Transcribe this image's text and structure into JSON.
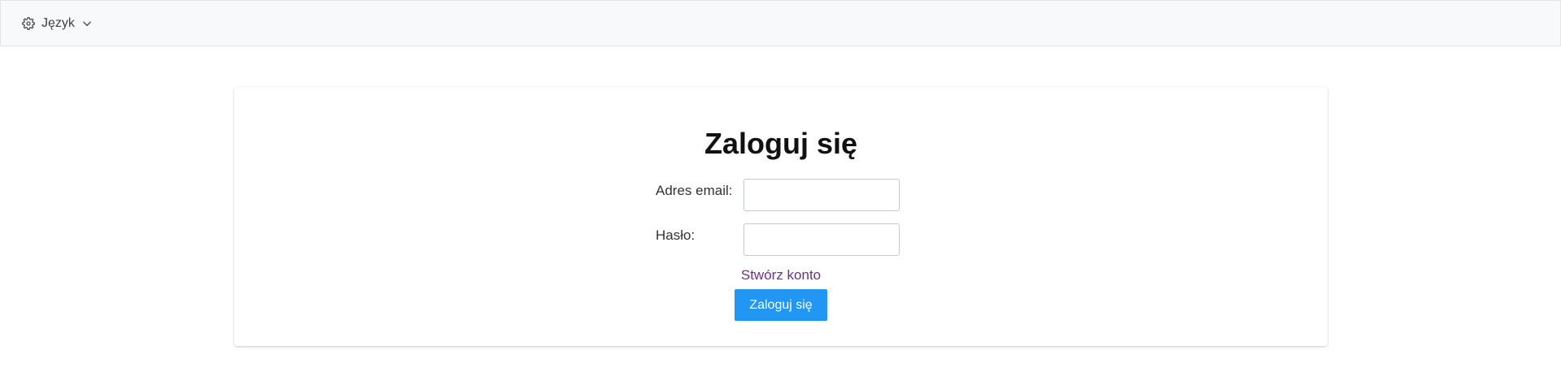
{
  "header": {
    "language_label": "Język",
    "language_icon": "gear-icon",
    "dropdown_icon": "chevron-down-icon"
  },
  "login": {
    "title": "Zaloguj się",
    "email_label": "Adres email:",
    "email_value": "",
    "password_label": "Hasło:",
    "password_value": "",
    "create_account_link": "Stwórz konto",
    "submit_label": "Zaloguj się"
  },
  "colors": {
    "topbar_background": "#f8f9fa",
    "link": "#6b2f86",
    "primary_button": "#2196f3"
  }
}
